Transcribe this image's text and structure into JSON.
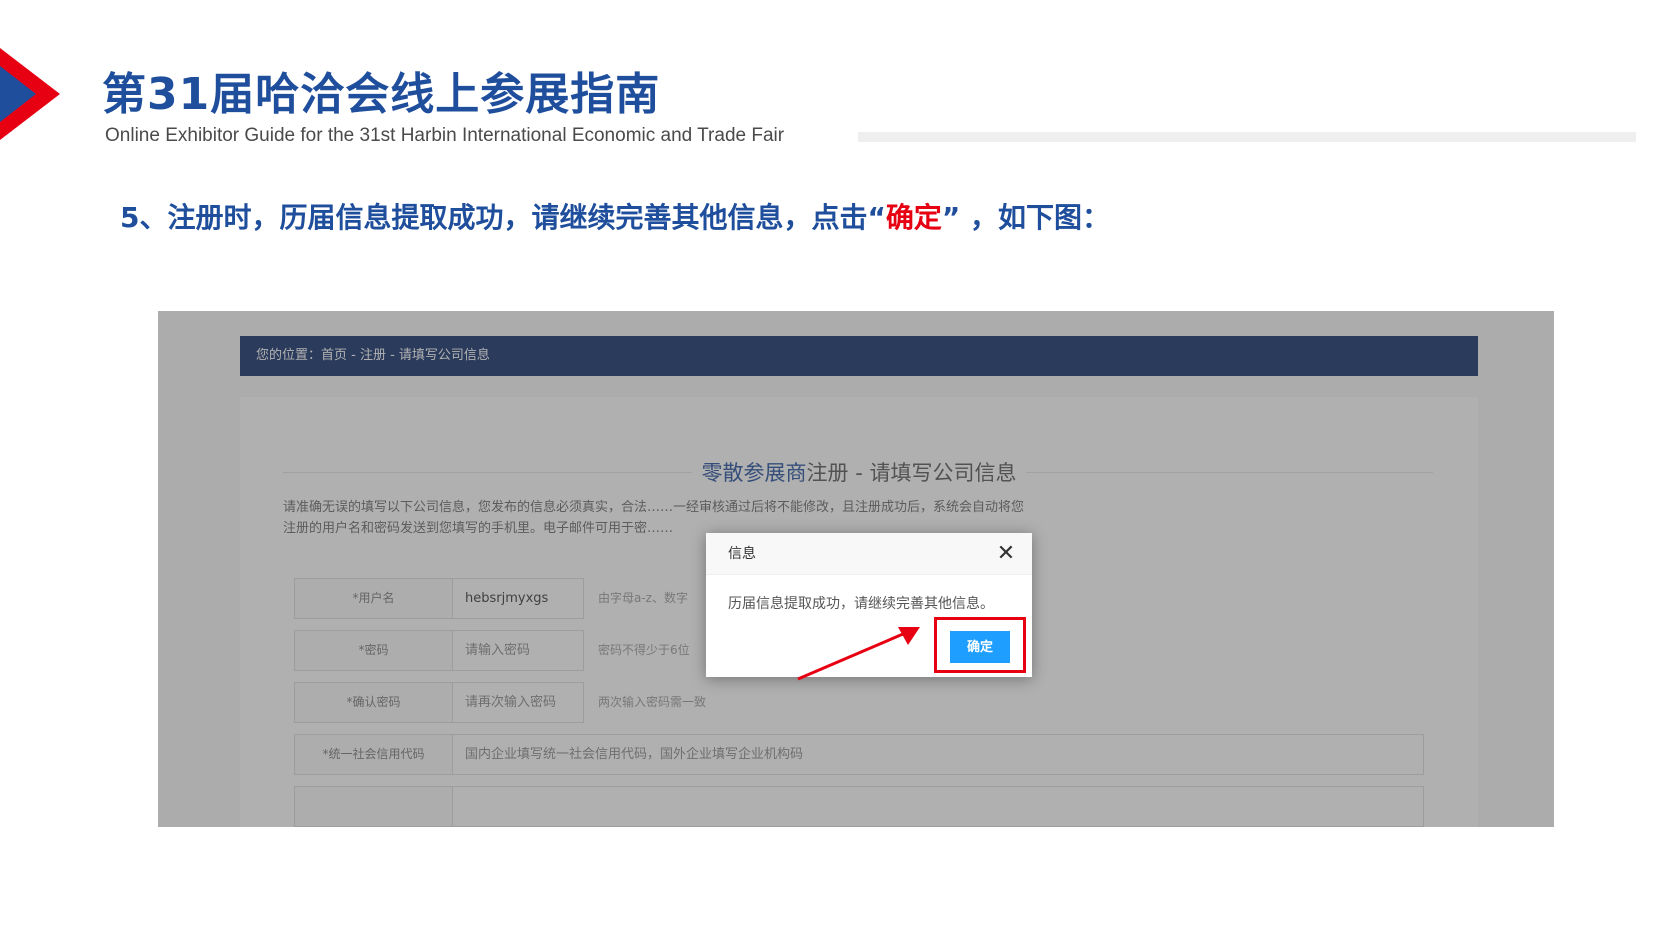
{
  "header": {
    "title": "第31届哈洽会线上参展指南",
    "subtitle": "Online Exhibitor Guide for the 31st Harbin International Economic and Trade Fair"
  },
  "step": {
    "prefix": "5、注册时，历届信息提取成功，请继续完善其他信息，点击“",
    "highlight": "确定",
    "suffix": "” ，如下图："
  },
  "screenshot": {
    "breadcrumb": "您的位置：首页 - 注册 - 请填写公司信息",
    "form_title_blue": "零散参展商",
    "form_title_rest": "注册 - 请填写公司信息",
    "notice_line1": "请准确无误的填写以下公司信息，您发布的信息必须真实，合法……一经审核通过后将不能修改，且注册成功后，系统会自动将您",
    "notice_line2": "注册的用户名和密码发送到您填写的手机里。电子邮件可用于密……",
    "fields": [
      {
        "label": "*用户名",
        "value": "hebsrjmyxgs",
        "hint": "由字母a-z、数字"
      },
      {
        "label": "*密码",
        "value": "请输入密码",
        "hint": "密码不得少于6位"
      },
      {
        "label": "*确认密码",
        "value": "请再次输入密码",
        "hint": "两次输入密码需一致"
      },
      {
        "label": "*统一社会信用代码",
        "value": "国内企业填写统一社会信用代码，国外企业填写企业机构码",
        "hint": ""
      }
    ],
    "dialog": {
      "title": "信息",
      "close": "✕",
      "message": "历届信息提取成功，请继续完善其他信息。",
      "ok_label": "确定"
    }
  },
  "colors": {
    "brand_blue": "#1f4e9c",
    "highlight_red": "#e60012",
    "nav_navy": "#0d2a66",
    "button_blue": "#1e9fff"
  }
}
